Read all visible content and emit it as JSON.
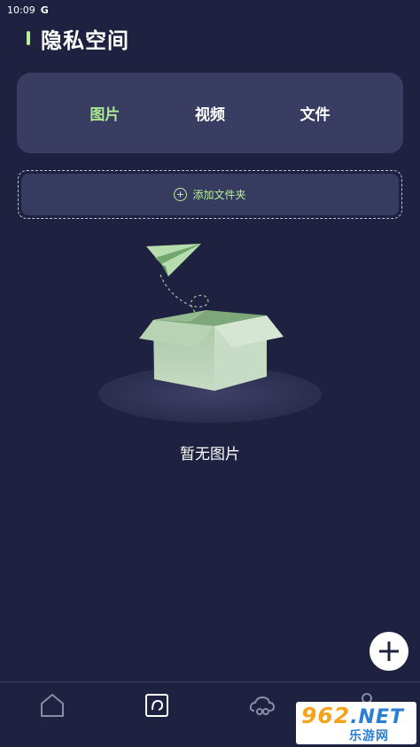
{
  "status_bar": {
    "time": "10:09",
    "carrier_icon": "G"
  },
  "header": {
    "title": "隐私空间"
  },
  "tabs": [
    {
      "label": "图片",
      "active": true
    },
    {
      "label": "视频",
      "active": false
    },
    {
      "label": "文件",
      "active": false
    }
  ],
  "add_folder": {
    "label": "添加文件夹",
    "icon": "plus-circle-icon"
  },
  "empty_state": {
    "message": "暂无图片"
  },
  "fab": {
    "icon": "plus-icon"
  },
  "bottom_nav": [
    {
      "icon": "home-icon",
      "active": false
    },
    {
      "icon": "photo-frame-icon",
      "active": true
    },
    {
      "icon": "cloud-icon",
      "active": false
    },
    {
      "icon": "user-icon",
      "active": false
    }
  ],
  "watermark": {
    "top_num": "962",
    "top_suffix": ".NET",
    "bottom": "乐游网"
  },
  "colors": {
    "background": "#1f2140",
    "card": "#3a3d62",
    "accent": "#a8e88f",
    "text": "#ffffff"
  }
}
